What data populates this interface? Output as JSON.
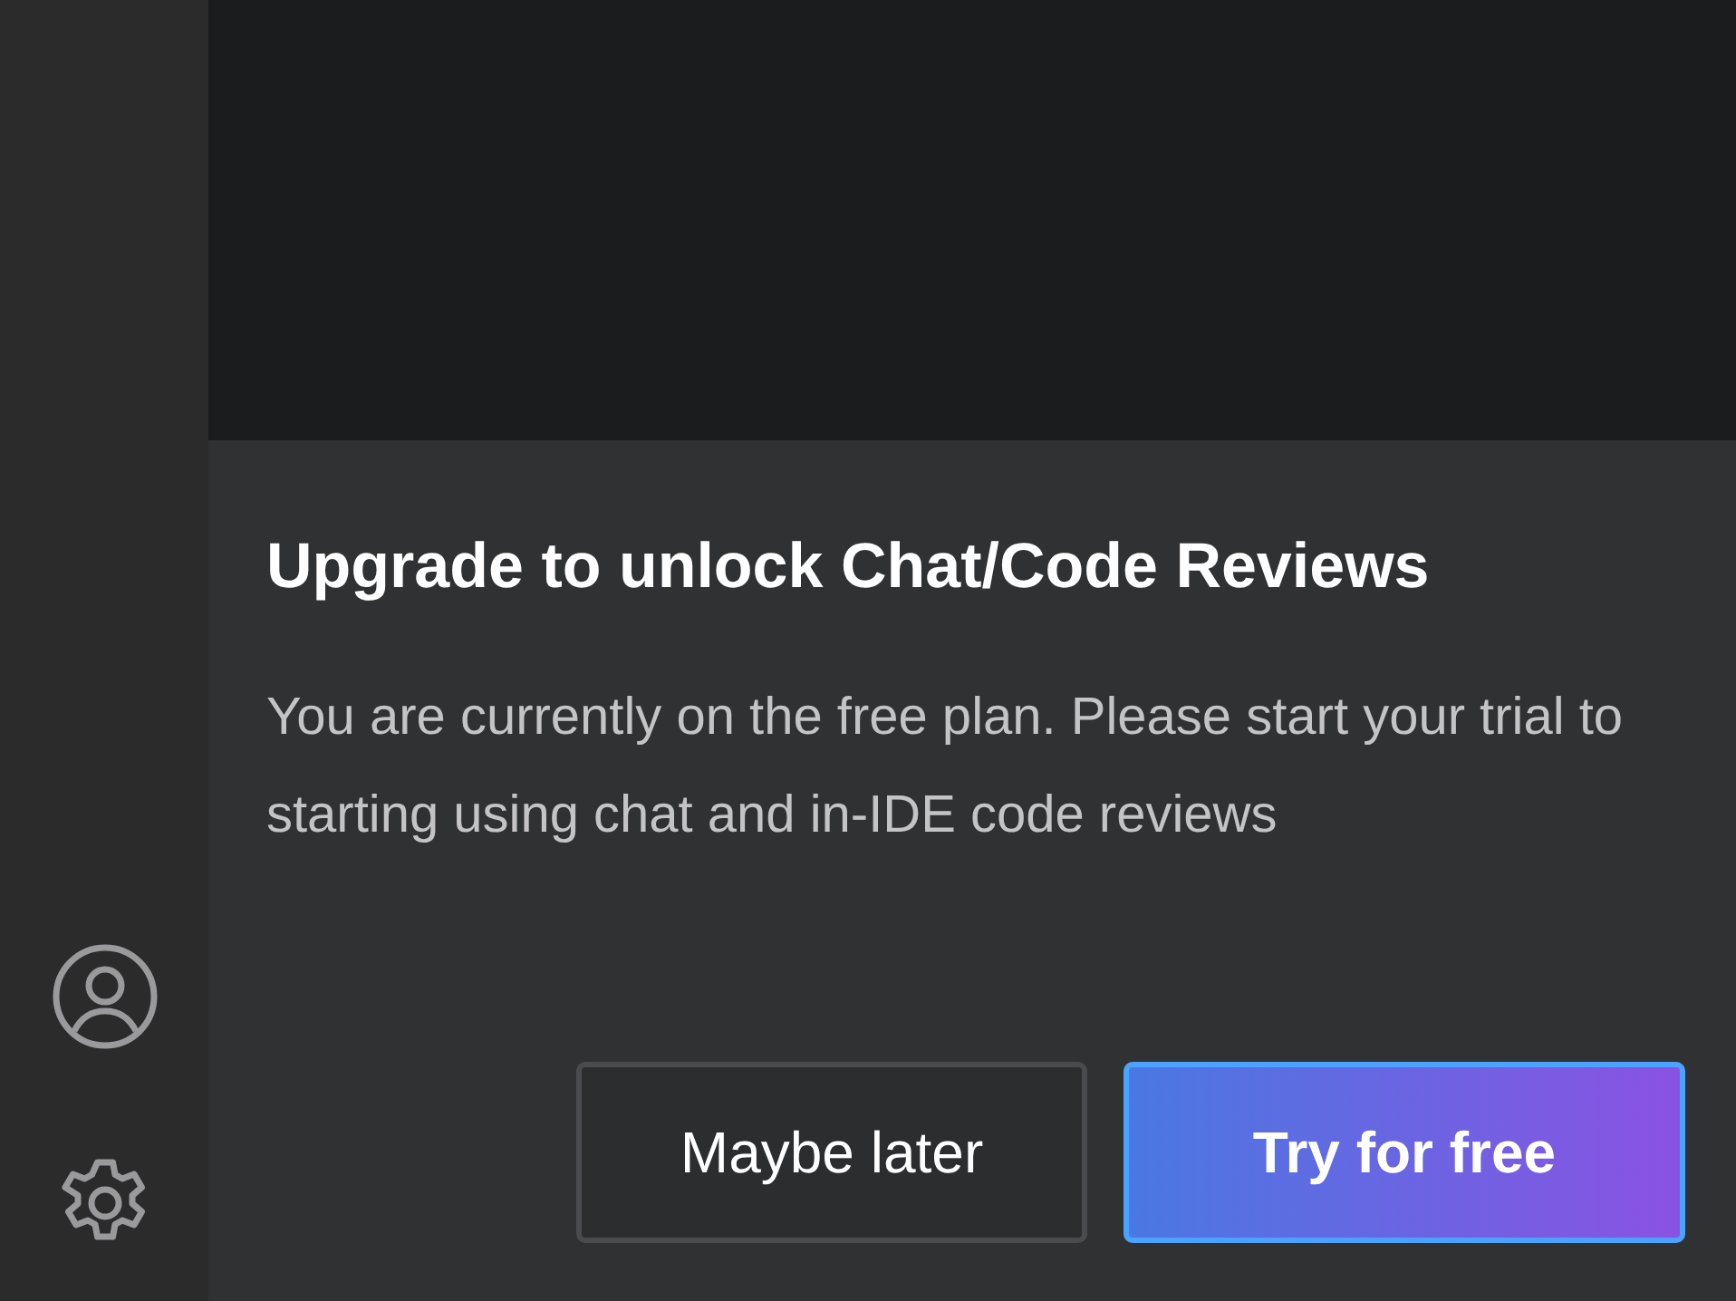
{
  "panel": {
    "title": "Upgrade to unlock Chat/Code Reviews",
    "message": "You are currently on the free plan. Please start your trial to starting using chat and in-IDE code reviews",
    "buttons": [
      {
        "label": "Maybe later",
        "kind": "secondary"
      },
      {
        "label": "Try for free",
        "kind": "primary"
      }
    ]
  }
}
